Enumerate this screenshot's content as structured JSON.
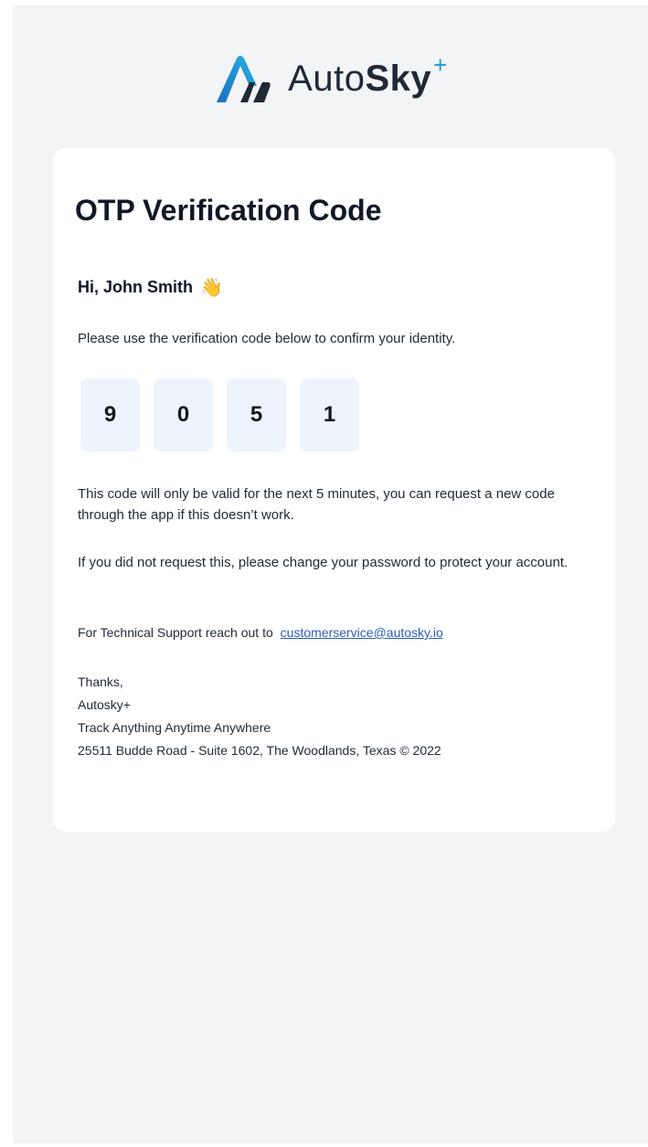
{
  "brand": {
    "name_light": "Auto",
    "name_bold": "Sky",
    "name_plus": "+",
    "logo_icon": "autosky-logo-icon",
    "accent_color": "#1e9ad9"
  },
  "email": {
    "title": "OTP Verification Code",
    "greeting": "Hi, John Smith",
    "greeting_icon": "waving-hand-icon",
    "instruction": "Please use the verification code below to confirm your identity.",
    "code_digits": [
      "9",
      "0",
      "5",
      "1"
    ],
    "validity_note": "This code will only be valid for the next 5 minutes, you can request a new code through the app if this doesn’t work.",
    "security_note": "If you did not request this, please change your password to protect your account.",
    "support_prefix": "For Technical Support reach out to",
    "support_email": "customerservice@autosky.io",
    "signoff": "Thanks,",
    "sender": "Autosky+",
    "tagline": "Track Anything Anytime Anywhere",
    "address": "25511 Budde Road - Suite 1602, The Woodlands, Texas © 2022"
  }
}
